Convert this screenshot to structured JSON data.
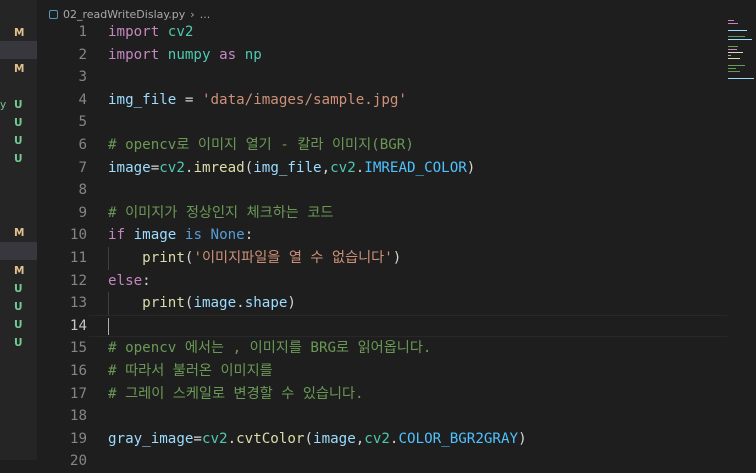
{
  "breadcrumb": {
    "file": "02_readWriteDislay.py",
    "more": "..."
  },
  "explorer": {
    "rows": [
      {
        "status": "M",
        "selected": false
      },
      {
        "status": "",
        "selected": true
      },
      {
        "status": "M",
        "selected": false
      },
      {
        "status": "U",
        "marker": "y"
      },
      {
        "status": "U"
      },
      {
        "status": "U"
      },
      {
        "status": "U"
      },
      {
        "status": "M",
        "selected": false
      },
      {
        "status": "",
        "selected": true
      },
      {
        "status": "M"
      },
      {
        "status": "U"
      },
      {
        "status": "U"
      },
      {
        "status": "U"
      },
      {
        "status": "U"
      }
    ]
  },
  "code": {
    "current_line": 14,
    "lines": [
      {
        "n": "1",
        "tokens": [
          [
            "kw",
            "import"
          ],
          [
            "t",
            " "
          ],
          [
            "cls",
            "cv2"
          ]
        ]
      },
      {
        "n": "2",
        "tokens": [
          [
            "kw",
            "import"
          ],
          [
            "t",
            " "
          ],
          [
            "cls",
            "numpy"
          ],
          [
            "t",
            " "
          ],
          [
            "kw",
            "as"
          ],
          [
            "t",
            " "
          ],
          [
            "cls",
            "np"
          ]
        ]
      },
      {
        "n": "3",
        "tokens": []
      },
      {
        "n": "4",
        "tokens": [
          [
            "var",
            "img_file"
          ],
          [
            "t",
            " = "
          ],
          [
            "str",
            "'data/images/sample.jpg'"
          ]
        ]
      },
      {
        "n": "5",
        "tokens": []
      },
      {
        "n": "6",
        "tokens": [
          [
            "com",
            "# opencv로 이미지 열기 - 칼라 이미지(BGR)"
          ]
        ]
      },
      {
        "n": "7",
        "tokens": [
          [
            "var",
            "image"
          ],
          [
            "t",
            "="
          ],
          [
            "cls",
            "cv2"
          ],
          [
            "t",
            "."
          ],
          [
            "fn",
            "imread"
          ],
          [
            "t",
            "("
          ],
          [
            "var",
            "img_file"
          ],
          [
            "t",
            ","
          ],
          [
            "cls",
            "cv2"
          ],
          [
            "t",
            "."
          ],
          [
            "con",
            "IMREAD_COLOR"
          ],
          [
            "t",
            ")"
          ]
        ]
      },
      {
        "n": "8",
        "tokens": []
      },
      {
        "n": "9",
        "tokens": [
          [
            "com",
            "# 이미지가 정상인지 체크하는 코드"
          ]
        ]
      },
      {
        "n": "10",
        "tokens": [
          [
            "kw",
            "if"
          ],
          [
            "t",
            " "
          ],
          [
            "var",
            "image"
          ],
          [
            "t",
            " "
          ],
          [
            "kb",
            "is"
          ],
          [
            "t",
            " "
          ],
          [
            "kb",
            "None"
          ],
          [
            "t",
            ":"
          ]
        ]
      },
      {
        "n": "11",
        "indent": true,
        "tokens": [
          [
            "t",
            "    "
          ],
          [
            "fn",
            "print"
          ],
          [
            "t",
            "("
          ],
          [
            "str",
            "'이미지파일을 열 수 없습니다'"
          ],
          [
            "t",
            ")"
          ]
        ]
      },
      {
        "n": "12",
        "tokens": [
          [
            "kw",
            "else"
          ],
          [
            "t",
            ":"
          ]
        ]
      },
      {
        "n": "13",
        "indent": true,
        "tokens": [
          [
            "t",
            "    "
          ],
          [
            "fn",
            "print"
          ],
          [
            "t",
            "("
          ],
          [
            "var",
            "image"
          ],
          [
            "t",
            "."
          ],
          [
            "var",
            "shape"
          ],
          [
            "t",
            ")"
          ]
        ]
      },
      {
        "n": "14",
        "tokens": []
      },
      {
        "n": "15",
        "tokens": [
          [
            "com",
            "# opencv 에서는 , 이미지를 BRG로 읽어옵니다."
          ]
        ]
      },
      {
        "n": "16",
        "tokens": [
          [
            "com",
            "# 따라서 불러온 이미지를"
          ]
        ]
      },
      {
        "n": "17",
        "tokens": [
          [
            "com",
            "# 그레이 스케일로 변경할 수 있습니다."
          ]
        ]
      },
      {
        "n": "18",
        "tokens": []
      },
      {
        "n": "19",
        "tokens": [
          [
            "var",
            "gray_image"
          ],
          [
            "t",
            "="
          ],
          [
            "cls",
            "cv2"
          ],
          [
            "t",
            "."
          ],
          [
            "fn",
            "cvtColor"
          ],
          [
            "t",
            "("
          ],
          [
            "var",
            "image"
          ],
          [
            "t",
            ","
          ],
          [
            "cls",
            "cv2"
          ],
          [
            "t",
            "."
          ],
          [
            "con",
            "COLOR_BGR2GRAY"
          ],
          [
            "t",
            ")"
          ]
        ]
      },
      {
        "n": "20",
        "tokens": []
      }
    ]
  }
}
